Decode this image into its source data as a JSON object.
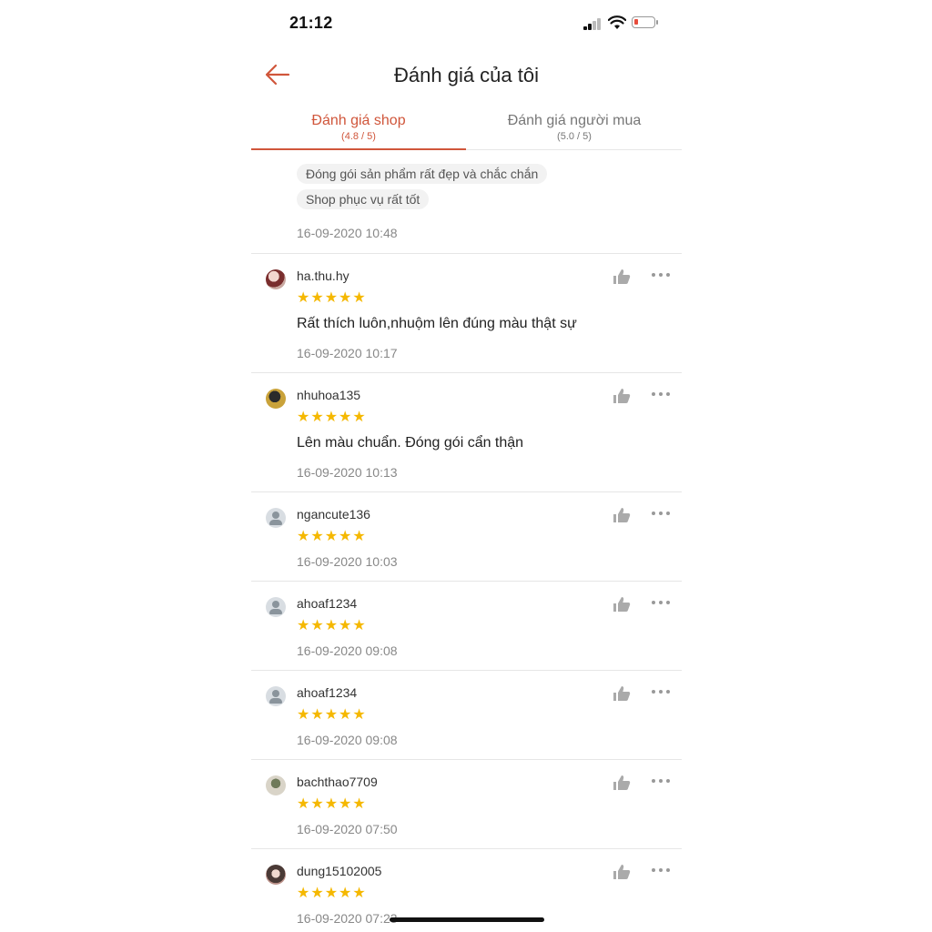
{
  "status_bar": {
    "time": "21:12"
  },
  "header": {
    "title": "Đánh giá của tôi"
  },
  "tabs": [
    {
      "label": "Đánh giá shop",
      "sub": "(4.8 / 5)",
      "active": true
    },
    {
      "label": "Đánh giá người mua",
      "sub": "(5.0 / 5)",
      "active": false
    }
  ],
  "partial_review": {
    "tags": [
      "Đóng gói sản phẩm rất đẹp và chắc chắn",
      "Shop phục vụ rất tốt"
    ],
    "date": "16-09-2020 10:48"
  },
  "reviews": [
    {
      "user": "ha.thu.hy",
      "rating": 5,
      "stars": "★★★★★",
      "comment": "Rất thích luôn,nhuộm lên đúng màu thật sự",
      "date": "16-09-2020 10:17",
      "avatar": "photo"
    },
    {
      "user": "nhuhoa135",
      "rating": 5,
      "stars": "★★★★★",
      "comment": "Lên màu chuẩn. Đóng gói cẩn thận",
      "date": "16-09-2020 10:13",
      "avatar": "photo"
    },
    {
      "user": "ngancute136",
      "rating": 5,
      "stars": "★★★★★",
      "comment": "",
      "date": "16-09-2020 10:03",
      "avatar": "default"
    },
    {
      "user": "ahoaf1234",
      "rating": 5,
      "stars": "★★★★★",
      "comment": "",
      "date": "16-09-2020 09:08",
      "avatar": "default"
    },
    {
      "user": "ahoaf1234",
      "rating": 5,
      "stars": "★★★★★",
      "comment": "",
      "date": "16-09-2020 09:08",
      "avatar": "default"
    },
    {
      "user": "bachthao7709",
      "rating": 5,
      "stars": "★★★★★",
      "comment": "",
      "date": "16-09-2020 07:50",
      "avatar": "photo"
    },
    {
      "user": "dung15102005",
      "rating": 5,
      "stars": "★★★★★",
      "comment": "",
      "date": "16-09-2020 07:23",
      "avatar": "photo"
    }
  ],
  "colors": {
    "accent": "#d0563b",
    "star": "#f5b800",
    "text_muted": "#888888"
  },
  "icons": {
    "back": "arrow-left-icon",
    "like": "thumbs-up-icon",
    "more": "more-horizontal-icon"
  }
}
